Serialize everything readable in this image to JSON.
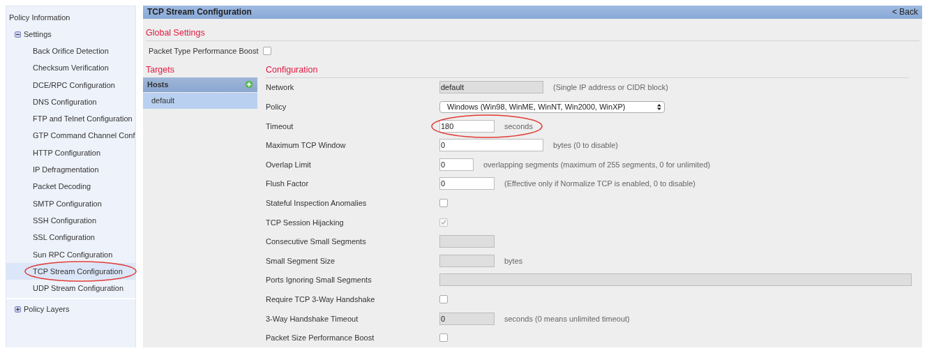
{
  "sidebar": {
    "title": "Policy Information",
    "groups": [
      {
        "label": "Settings",
        "expanded": true,
        "children": [
          {
            "label": "Back Orifice Detection",
            "selected": false
          },
          {
            "label": "Checksum Verification",
            "selected": false
          },
          {
            "label": "DCE/RPC Configuration",
            "selected": false
          },
          {
            "label": "DNS Configuration",
            "selected": false
          },
          {
            "label": "FTP and Telnet Configuration",
            "selected": false
          },
          {
            "label": "GTP Command Channel Conf",
            "selected": false
          },
          {
            "label": "HTTP Configuration",
            "selected": false
          },
          {
            "label": "IP Defragmentation",
            "selected": false
          },
          {
            "label": "Packet Decoding",
            "selected": false
          },
          {
            "label": "SMTP Configuration",
            "selected": false
          },
          {
            "label": "SSH Configuration",
            "selected": false
          },
          {
            "label": "SSL Configuration",
            "selected": false
          },
          {
            "label": "Sun RPC Configuration",
            "selected": false
          },
          {
            "label": "TCP Stream Configuration",
            "selected": true,
            "circled": true
          },
          {
            "label": "UDP Stream Configuration",
            "selected": false
          }
        ]
      },
      {
        "label": "Policy Layers",
        "expanded": false
      }
    ]
  },
  "panel": {
    "title": "TCP Stream Configuration",
    "back": "< Back",
    "global_settings": {
      "heading": "Global Settings",
      "fields": [
        {
          "label": "Packet Type Performance Boost",
          "checked": false
        }
      ]
    },
    "targets": {
      "heading": "Targets",
      "list_title": "Hosts",
      "items": [
        {
          "label": "default",
          "selected": true
        }
      ]
    },
    "configuration": {
      "heading": "Configuration",
      "rows": [
        {
          "kind": "long_text",
          "label": "Network",
          "value": "default",
          "disabled": true,
          "hint": "(Single IP address or CIDR block)"
        },
        {
          "kind": "select",
          "label": "Policy",
          "value": "Windows (Win98, WinME, WinNT, Win2000, WinXP)"
        },
        {
          "kind": "text",
          "label": "Timeout",
          "value": "180",
          "disabled": false,
          "hint": "seconds",
          "circled": true
        },
        {
          "kind": "long_text",
          "label": "Maximum TCP Window",
          "value": "0",
          "disabled": false,
          "hint": "bytes (0 to disable)"
        },
        {
          "kind": "short_text",
          "label": "Overlap Limit",
          "value": "0",
          "disabled": false,
          "hint": "overlapping segments (maximum of 255 segments, 0 for unlimited)"
        },
        {
          "kind": "text",
          "label": "Flush Factor",
          "value": "0",
          "disabled": false,
          "hint": "(Effective only if Normalize TCP is enabled, 0 to disable)"
        },
        {
          "kind": "checkbox",
          "label": "Stateful Inspection Anomalies",
          "checked": false,
          "disabled": false
        },
        {
          "kind": "checkbox",
          "label": "TCP Session Hijacking",
          "checked": true,
          "disabled": true
        },
        {
          "kind": "text",
          "label": "Consecutive Small Segments",
          "disabled": true
        },
        {
          "kind": "text",
          "label": "Small Segment Size",
          "disabled": true,
          "hint": "bytes"
        },
        {
          "kind": "wide_text",
          "label": "Ports Ignoring Small Segments",
          "disabled": true
        },
        {
          "kind": "checkbox",
          "label": "Require TCP 3-Way Handshake",
          "checked": false,
          "disabled": false
        },
        {
          "kind": "text",
          "label": "3-Way Handshake Timeout",
          "value": "0",
          "disabled": true,
          "hint": "seconds (0 means unlimited timeout)"
        },
        {
          "kind": "checkbox",
          "label": "Packet Size Performance Boost",
          "checked": false,
          "disabled": false
        }
      ]
    }
  }
}
